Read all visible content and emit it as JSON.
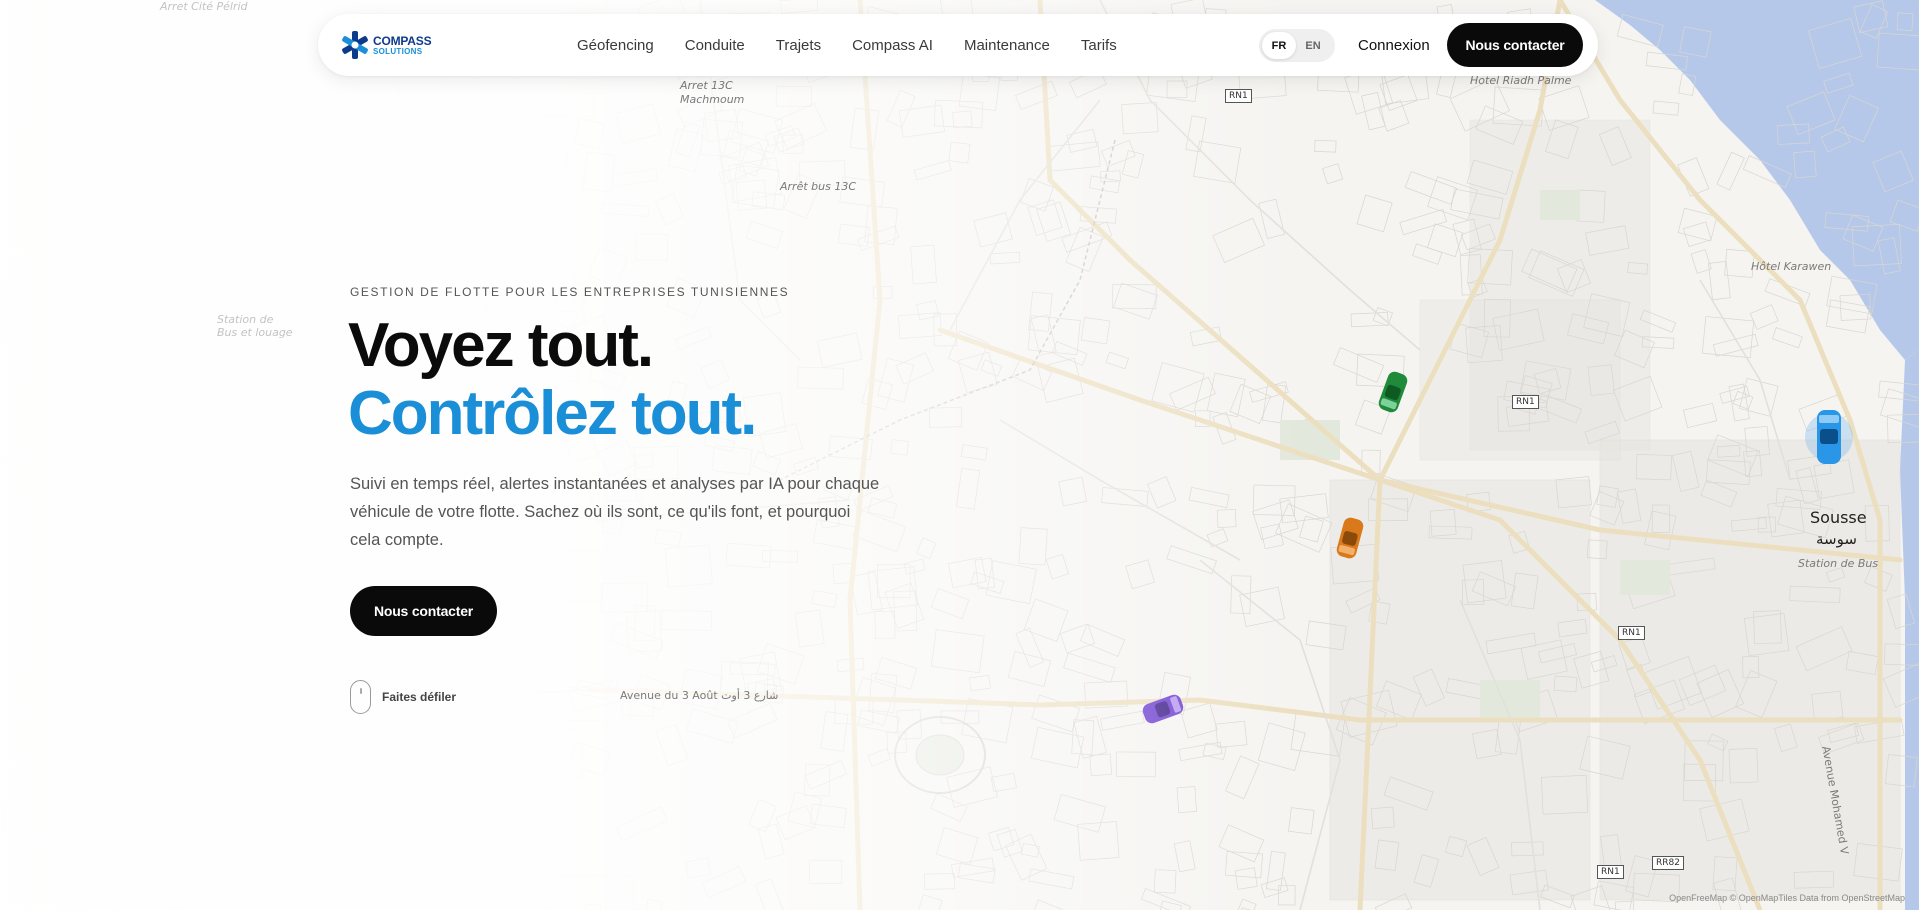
{
  "brand": {
    "name": "COMPASS",
    "sub": "SOLUTIONS",
    "colors": {
      "primary": "#0d3b8c",
      "accent": "#1a8fd8"
    }
  },
  "nav": {
    "links": [
      "Géofencing",
      "Conduite",
      "Trajets",
      "Compass AI",
      "Maintenance",
      "Tarifs"
    ],
    "lang": {
      "fr": "FR",
      "en": "EN",
      "active": "FR"
    },
    "login": "Connexion",
    "cta": "Nous contacter"
  },
  "hero": {
    "eyebrow": "GESTION DE FLOTTE POUR LES ENTREPRISES TUNISIENNES",
    "title_line1": "Voyez tout.",
    "title_line2": "Contrôlez tout.",
    "lead": "Suivi en temps réel, alertes instantanées et analyses par IA pour chaque véhicule de votre flotte. Sachez où ils sont, ce qu'ils font, et pourquoi cela compte.",
    "cta": "Nous contacter",
    "scroll": "Faites défiler"
  },
  "map": {
    "city": "Sousse",
    "city_ar": "سوسة",
    "labels": {
      "arret_13c": "Arret 13C",
      "machmoum": "Machmoum",
      "arret_bus_13c": "Arrêt bus 13C",
      "hotel_karawen": "Hôtel Karawen",
      "hotel_palme": "Hotel Riadh Palme",
      "station_bus": "Station de Bus",
      "avenue_3_aout": "Avenue du 3 Août  شارع 3 أوت",
      "avenue_mohamed": "Avenue Mohamed V",
      "station_bus_left": "Station de Bus et louage",
      "arret_top": "Arret Cité Pélrid",
      "rn_a": "RN1",
      "rn_b": "RN1",
      "rn_c": "RN1",
      "rn_d": "RN1",
      "rr82": "RR82"
    },
    "vehicles": [
      {
        "name": "green",
        "color": "#1f8a3a"
      },
      {
        "name": "orange",
        "color": "#d9791a"
      },
      {
        "name": "purple",
        "color": "#6d3fd1"
      },
      {
        "name": "blue",
        "color": "#2996e8"
      }
    ],
    "attribution": "OpenFreeMap © OpenMapTiles Data from OpenStreetMap"
  }
}
